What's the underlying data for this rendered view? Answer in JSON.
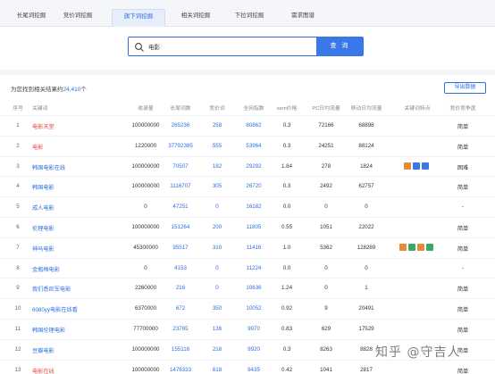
{
  "tabs": [
    {
      "label": "长尾词挖掘",
      "active": false
    },
    {
      "label": "竞价词挖掘",
      "active": false
    },
    {
      "label": "旗下词挖掘",
      "active": true
    },
    {
      "label": "相关词挖掘",
      "active": false
    },
    {
      "label": "下拉词挖掘",
      "active": false
    },
    {
      "label": "需求图谱",
      "active": false
    }
  ],
  "search": {
    "value": "电影",
    "button_label": "查 询"
  },
  "results": {
    "prefix": "为您找到相关结果约",
    "count": "24,410",
    "suffix": "个",
    "export_label": "导出数据"
  },
  "table": {
    "columns": [
      "序号",
      "关键词",
      "收录量",
      "长尾词数",
      "竞价词",
      "全网指数",
      "sem价格",
      "PC日均流量",
      "移动日均流量",
      "关键词特点",
      "竞价竞争度"
    ],
    "rows": [
      {
        "idx": "1",
        "kw": "电影天堂",
        "kw_color": "red",
        "sl": "100000000",
        "cw": "265236",
        "jj": "258",
        "qw": "80862",
        "sem": "0.3",
        "pc": "72166",
        "yd": "68898",
        "icons": [],
        "jz": "简单"
      },
      {
        "idx": "2",
        "kw": "电影",
        "kw_color": "red",
        "sl": "1220000",
        "cw": "37792385",
        "jj": "555",
        "qw": "53964",
        "sem": "0.3",
        "pc": "24251",
        "yd": "88124",
        "icons": [],
        "jz": "简单"
      },
      {
        "idx": "3",
        "kw": "韩国电影在线",
        "kw_color": "blue",
        "sl": "100000000",
        "cw": "70507",
        "jj": "182",
        "qw": "29292",
        "sem": "1.84",
        "pc": "278",
        "yd": "1824",
        "icons": [
          "#e8893a",
          "#3a78e7",
          "#3a78e7"
        ],
        "jz": "困难"
      },
      {
        "idx": "4",
        "kw": "韩国电影",
        "kw_color": "blue",
        "sl": "100000000",
        "cw": "1116707",
        "jj": "305",
        "qw": "26720",
        "sem": "0.3",
        "pc": "2492",
        "yd": "62757",
        "icons": [],
        "jz": "简单"
      },
      {
        "idx": "5",
        "kw": "成人电影",
        "kw_color": "blue",
        "sl": "0",
        "cw": "47251",
        "jj": "0",
        "qw": "16182",
        "sem": "0.0",
        "pc": "0",
        "yd": "0",
        "icons": [],
        "jz": "-"
      },
      {
        "idx": "6",
        "kw": "伦理电影",
        "kw_color": "blue",
        "sl": "100000000",
        "cw": "151264",
        "jj": "200",
        "qw": "11805",
        "sem": "0.55",
        "pc": "1051",
        "yd": "22022",
        "icons": [],
        "jz": "简单"
      },
      {
        "idx": "7",
        "kw": "神马电影",
        "kw_color": "blue",
        "sl": "45300000",
        "cw": "95517",
        "jj": "310",
        "qw": "11416",
        "sem": "1.0",
        "pc": "5362",
        "yd": "128289",
        "icons": [
          "#e8893a",
          "#3aa86a",
          "#e8893a",
          "#3aa86a"
        ],
        "jz": "简单"
      },
      {
        "idx": "8",
        "kw": "金瓶梅电影",
        "kw_color": "blue",
        "sl": "0",
        "cw": "4153",
        "jj": "0",
        "qw": "11224",
        "sem": "0.0",
        "pc": "0",
        "yd": "0",
        "icons": [],
        "jz": "-"
      },
      {
        "idx": "9",
        "kw": "我们悉尼军电影",
        "kw_color": "blue",
        "sl": "2260000",
        "cw": "216",
        "jj": "0",
        "qw": "10636",
        "sem": "1.24",
        "pc": "0",
        "yd": "1",
        "icons": [],
        "jz": "简单"
      },
      {
        "idx": "10",
        "kw": "6080yy电影在线看",
        "kw_color": "blue",
        "sl": "6370000",
        "cw": "672",
        "jj": "350",
        "qw": "10052",
        "sem": "0.92",
        "pc": "9",
        "yd": "20491",
        "icons": [],
        "jz": "简单"
      },
      {
        "idx": "11",
        "kw": "韩国伦理电影",
        "kw_color": "blue",
        "sl": "77700000",
        "cw": "23765",
        "jj": "136",
        "qw": "9970",
        "sem": "0.83",
        "pc": "629",
        "yd": "17529",
        "icons": [],
        "jz": "简单"
      },
      {
        "idx": "12",
        "kw": "豆瓣电影",
        "kw_color": "blue",
        "sl": "100000000",
        "cw": "155116",
        "jj": "218",
        "qw": "9920",
        "sem": "0.3",
        "pc": "8263",
        "yd": "8828",
        "icons": [],
        "jz": "简单"
      },
      {
        "idx": "13",
        "kw": "电影在线",
        "kw_color": "red",
        "sl": "100000000",
        "cw": "1476333",
        "jj": "618",
        "qw": "9435",
        "sem": "0.42",
        "pc": "1041",
        "yd": "2817",
        "icons": [],
        "jz": "简单"
      }
    ]
  },
  "watermark": "知乎 @守吉人"
}
